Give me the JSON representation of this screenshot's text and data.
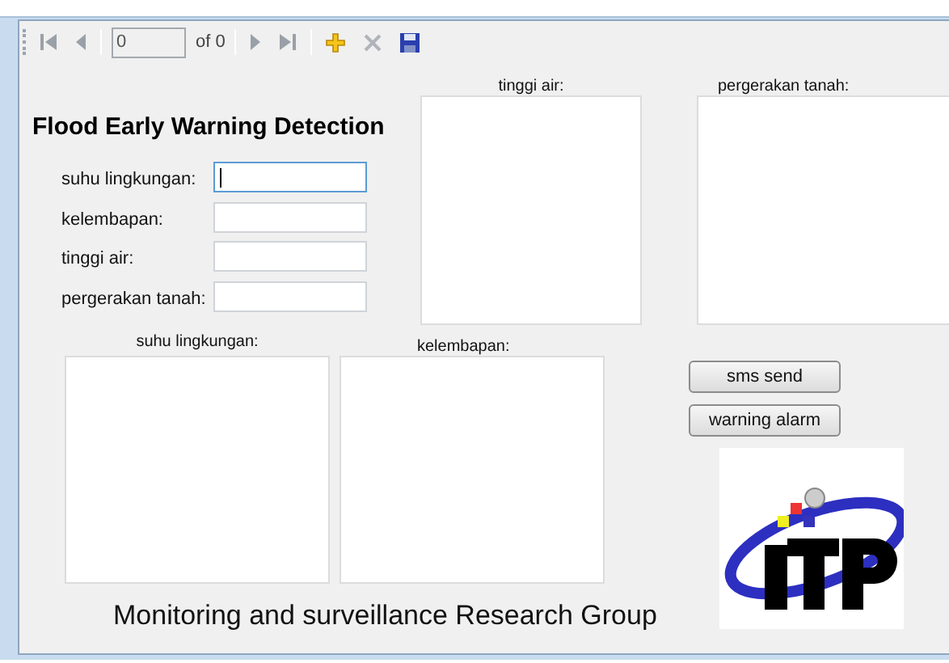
{
  "toolbar": {
    "items": [
      {
        "kind": "first",
        "disabled": true
      },
      {
        "kind": "prev",
        "disabled": true
      },
      {
        "kind": "separator"
      },
      {
        "kind": "position",
        "value": "0"
      },
      {
        "kind": "count",
        "text": "of 0"
      },
      {
        "kind": "separator"
      },
      {
        "kind": "next",
        "disabled": true
      },
      {
        "kind": "last",
        "disabled": true
      },
      {
        "kind": "separator"
      },
      {
        "kind": "add",
        "disabled": false
      },
      {
        "kind": "delete",
        "disabled": true
      },
      {
        "kind": "save",
        "disabled": false
      }
    ]
  },
  "title": "Flood Early Warning Detection",
  "fields": [
    {
      "label": "suhu lingkungan:",
      "focused": true
    },
    {
      "label": "kelembapan:",
      "focused": false
    },
    {
      "label": "tinggi air:",
      "focused": false
    },
    {
      "label": "pergerakan tanah:",
      "focused": false
    }
  ],
  "charts": [
    {
      "label": "tinggi air:"
    },
    {
      "label": "pergerakan tanah:"
    },
    {
      "label": "suhu lingkungan:"
    },
    {
      "label": "kelembapan:"
    }
  ],
  "buttons": [
    "sms send",
    "warning alarm"
  ],
  "footer": "Monitoring and surveillance Research Group"
}
